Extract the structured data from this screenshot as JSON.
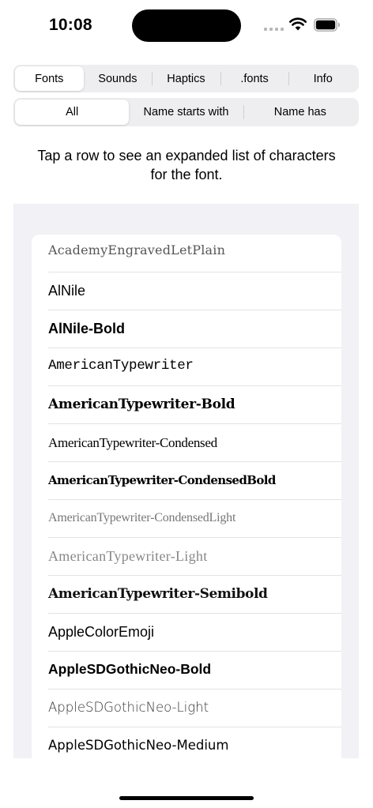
{
  "status_bar": {
    "time": "10:08",
    "icons": [
      "cellular-signal-icon",
      "wifi-icon",
      "battery-icon"
    ]
  },
  "tabs": [
    {
      "label": "Fonts",
      "selected": true
    },
    {
      "label": "Sounds",
      "selected": false
    },
    {
      "label": "Haptics",
      "selected": false
    },
    {
      "label": ".fonts",
      "selected": false
    },
    {
      "label": "Info",
      "selected": false
    }
  ],
  "filters": [
    {
      "label": "All",
      "selected": true
    },
    {
      "label": "Name starts with",
      "selected": false
    },
    {
      "label": "Name has",
      "selected": false
    }
  ],
  "instruction": "Tap a row to see an expanded list of characters for the font.",
  "fonts": [
    "AcademyEngravedLetPlain",
    "AlNile",
    "AlNile-Bold",
    "AmericanTypewriter",
    "AmericanTypewriter-Bold",
    "AmericanTypewriter-Condensed",
    "AmericanTypewriter-CondensedBold",
    "AmericanTypewriter-CondensedLight",
    "AmericanTypewriter-Light",
    "AmericanTypewriter-Semibold",
    "AppleColorEmoji",
    "AppleSDGothicNeo-Bold",
    "AppleSDGothicNeo-Light",
    "AppleSDGothicNeo-Medium"
  ],
  "colors": {
    "background": "#ffffff",
    "segment_track": "#eeeef0",
    "list_background": "#f1f1f6",
    "separator": "#e3e3e6"
  }
}
